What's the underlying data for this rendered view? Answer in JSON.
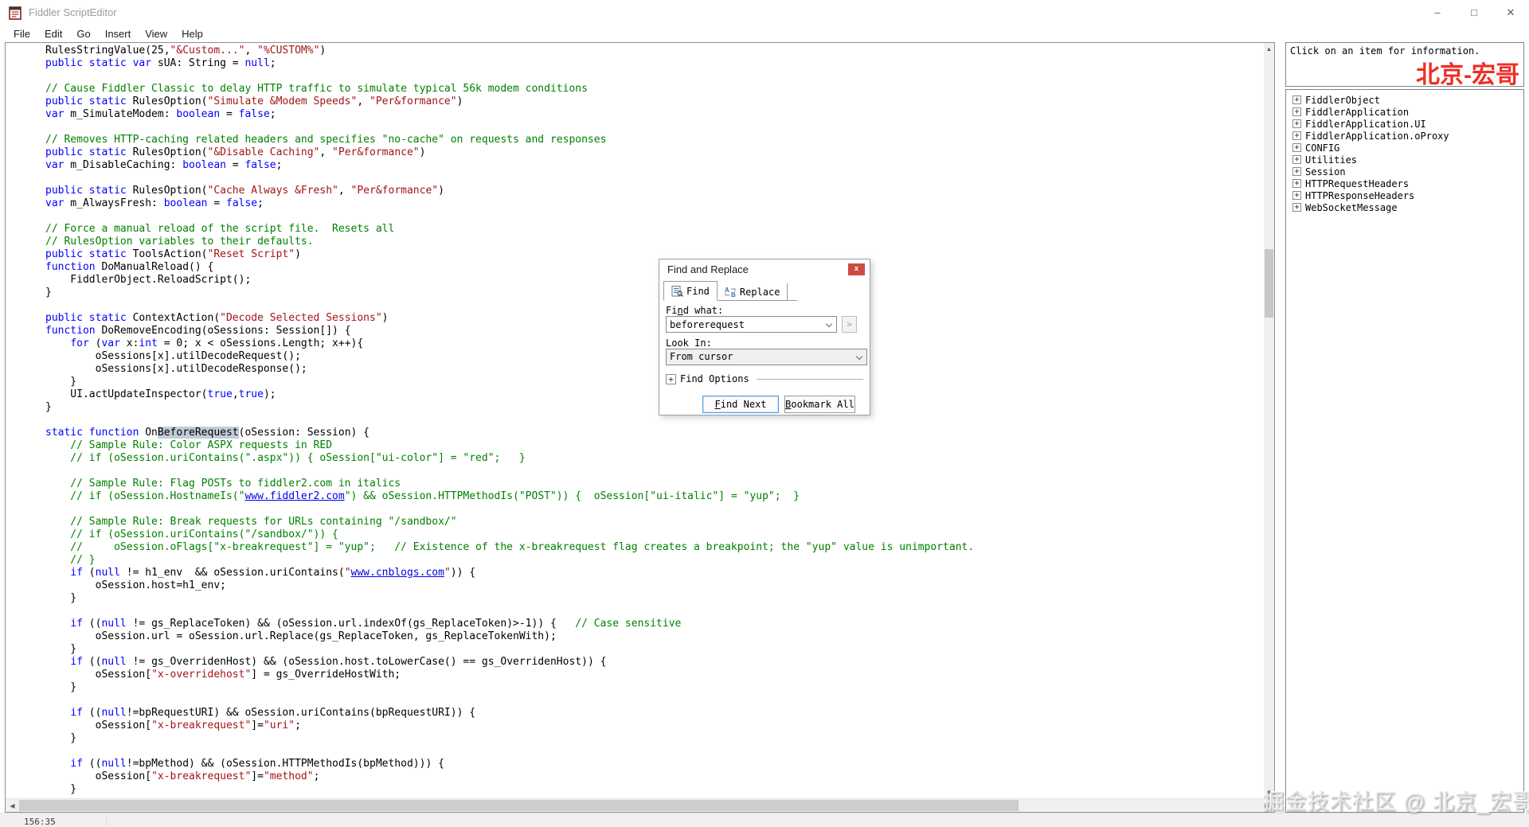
{
  "window": {
    "title": "Fiddler ScriptEditor",
    "menu": [
      "File",
      "Edit",
      "Go",
      "Insert",
      "View",
      "Help"
    ],
    "controls": {
      "minimize": "–",
      "maximize": "□",
      "close": "✕"
    }
  },
  "editor": {
    "status": "156:35",
    "lines": [
      [
        [
          "p",
          "RulesStringValue(25,"
        ],
        [
          "s",
          "\"&Custom...\""
        ],
        [
          "p",
          ", "
        ],
        [
          "s",
          "\"%CUSTOM%\""
        ],
        [
          "p",
          ")"
        ]
      ],
      [
        [
          "k",
          "public static var"
        ],
        [
          "p",
          " sUA: String = "
        ],
        [
          "k",
          "null"
        ],
        [
          "p",
          ";"
        ]
      ],
      [],
      [
        [
          "c",
          "// Cause Fiddler Classic to delay HTTP traffic to simulate typical 56k modem conditions"
        ]
      ],
      [
        [
          "k",
          "public static"
        ],
        [
          "p",
          " RulesOption("
        ],
        [
          "s",
          "\"Simulate &Modem Speeds\""
        ],
        [
          "p",
          ", "
        ],
        [
          "s",
          "\"Per&formance\""
        ],
        [
          "p",
          ")"
        ]
      ],
      [
        [
          "k",
          "var"
        ],
        [
          "p",
          " m_SimulateModem: "
        ],
        [
          "k",
          "boolean"
        ],
        [
          "p",
          " = "
        ],
        [
          "k",
          "false"
        ],
        [
          "p",
          ";"
        ]
      ],
      [],
      [
        [
          "c",
          "// Removes HTTP-caching related headers and specifies \"no-cache\" on requests and responses"
        ]
      ],
      [
        [
          "k",
          "public static"
        ],
        [
          "p",
          " RulesOption("
        ],
        [
          "s",
          "\"&Disable Caching\""
        ],
        [
          "p",
          ", "
        ],
        [
          "s",
          "\"Per&formance\""
        ],
        [
          "p",
          ")"
        ]
      ],
      [
        [
          "k",
          "var"
        ],
        [
          "p",
          " m_DisableCaching: "
        ],
        [
          "k",
          "boolean"
        ],
        [
          "p",
          " = "
        ],
        [
          "k",
          "false"
        ],
        [
          "p",
          ";"
        ]
      ],
      [],
      [
        [
          "k",
          "public static"
        ],
        [
          "p",
          " RulesOption("
        ],
        [
          "s",
          "\"Cache Always &Fresh\""
        ],
        [
          "p",
          ", "
        ],
        [
          "s",
          "\"Per&formance\""
        ],
        [
          "p",
          ")"
        ]
      ],
      [
        [
          "k",
          "var"
        ],
        [
          "p",
          " m_AlwaysFresh: "
        ],
        [
          "k",
          "boolean"
        ],
        [
          "p",
          " = "
        ],
        [
          "k",
          "false"
        ],
        [
          "p",
          ";"
        ]
      ],
      [],
      [
        [
          "c",
          "// Force a manual reload of the script file.  Resets all"
        ]
      ],
      [
        [
          "c",
          "// RulesOption variables to their defaults."
        ]
      ],
      [
        [
          "k",
          "public static"
        ],
        [
          "p",
          " ToolsAction("
        ],
        [
          "s",
          "\"Reset Script\""
        ],
        [
          "p",
          ")"
        ]
      ],
      [
        [
          "k",
          "function"
        ],
        [
          "p",
          " DoManualReload() {"
        ]
      ],
      [
        [
          "p",
          "    FiddlerObject.ReloadScript();"
        ]
      ],
      [
        [
          "p",
          "}"
        ]
      ],
      [],
      [
        [
          "k",
          "public static"
        ],
        [
          "p",
          " ContextAction("
        ],
        [
          "s",
          "\"Decode Selected Sessions\""
        ],
        [
          "p",
          ")"
        ]
      ],
      [
        [
          "k",
          "function"
        ],
        [
          "p",
          " DoRemoveEncoding(oSessions: Session[]) {"
        ]
      ],
      [
        [
          "p",
          "    "
        ],
        [
          "k",
          "for"
        ],
        [
          "p",
          " ("
        ],
        [
          "k",
          "var"
        ],
        [
          "p",
          " x:"
        ],
        [
          "k",
          "int"
        ],
        [
          "p",
          " = 0; x < oSessions.Length; x++){"
        ]
      ],
      [
        [
          "p",
          "        oSessions[x].utilDecodeRequest();"
        ]
      ],
      [
        [
          "p",
          "        oSessions[x].utilDecodeResponse();"
        ]
      ],
      [
        [
          "p",
          "    }"
        ]
      ],
      [
        [
          "p",
          "    UI.actUpdateInspector("
        ],
        [
          "k",
          "true"
        ],
        [
          "p",
          ","
        ],
        [
          "k",
          "true"
        ],
        [
          "p",
          ");"
        ]
      ],
      [
        [
          "p",
          "}"
        ]
      ],
      [],
      [
        [
          "k",
          "static function"
        ],
        [
          "p",
          " On"
        ],
        [
          "hl",
          "BeforeRequest"
        ],
        [
          "p",
          "(oSession: Session) {"
        ]
      ],
      [
        [
          "c",
          "    // Sample Rule: Color ASPX requests in RED"
        ]
      ],
      [
        [
          "c",
          "    // if (oSession.uriContains(\".aspx\")) { oSession[\"ui-color\"] = \"red\";   }"
        ]
      ],
      [],
      [
        [
          "c",
          "    // Sample Rule: Flag POSTs to fiddler2.com in italics"
        ]
      ],
      [
        [
          "c",
          "    // if (oSession.HostnameIs(\""
        ],
        [
          "u",
          "www.fiddler2.com"
        ],
        [
          "c",
          "\") && oSession.HTTPMethodIs(\"POST\")) {  oSession[\"ui-italic\"] = \"yup\";  }"
        ]
      ],
      [],
      [
        [
          "c",
          "    // Sample Rule: Break requests for URLs containing \"/sandbox/\""
        ]
      ],
      [
        [
          "c",
          "    // if (oSession.uriContains(\"/sandbox/\")) {"
        ]
      ],
      [
        [
          "c",
          "    //     oSession.oFlags[\"x-breakrequest\"] = \"yup\";   // Existence of the x-breakrequest flag creates a breakpoint; the \"yup\" value is unimportant."
        ]
      ],
      [
        [
          "c",
          "    // }"
        ]
      ],
      [
        [
          "p",
          "    "
        ],
        [
          "k",
          "if"
        ],
        [
          "p",
          " ("
        ],
        [
          "k",
          "null"
        ],
        [
          "p",
          " != h1_env  && oSession.uriContains("
        ],
        [
          "s",
          "\""
        ],
        [
          "u",
          "www.cnblogs.com"
        ],
        [
          "s",
          "\""
        ],
        [
          "p",
          ")) {"
        ]
      ],
      [
        [
          "p",
          "        oSession.host=h1_env;"
        ]
      ],
      [
        [
          "p",
          "    }"
        ]
      ],
      [],
      [
        [
          "p",
          "    "
        ],
        [
          "k",
          "if"
        ],
        [
          "p",
          " (("
        ],
        [
          "k",
          "null"
        ],
        [
          "p",
          " != gs_ReplaceToken) && (oSession.url.indexOf(gs_ReplaceToken)>-1)) {   "
        ],
        [
          "c",
          "// Case sensitive"
        ]
      ],
      [
        [
          "p",
          "        oSession.url = oSession.url.Replace(gs_ReplaceToken, gs_ReplaceTokenWith);"
        ]
      ],
      [
        [
          "p",
          "    }"
        ]
      ],
      [
        [
          "p",
          "    "
        ],
        [
          "k",
          "if"
        ],
        [
          "p",
          " (("
        ],
        [
          "k",
          "null"
        ],
        [
          "p",
          " != gs_OverridenHost) && (oSession.host.toLowerCase() == gs_OverridenHost)) {"
        ]
      ],
      [
        [
          "p",
          "        oSession["
        ],
        [
          "s",
          "\"x-overridehost\""
        ],
        [
          "p",
          "] = gs_OverrideHostWith;"
        ]
      ],
      [
        [
          "p",
          "    }"
        ]
      ],
      [],
      [
        [
          "p",
          "    "
        ],
        [
          "k",
          "if"
        ],
        [
          "p",
          " (("
        ],
        [
          "k",
          "null"
        ],
        [
          "p",
          "!=bpRequestURI) && oSession.uriContains(bpRequestURI)) {"
        ]
      ],
      [
        [
          "p",
          "        oSession["
        ],
        [
          "s",
          "\"x-breakrequest\""
        ],
        [
          "p",
          "]="
        ],
        [
          "s",
          "\"uri\""
        ],
        [
          "p",
          ";"
        ]
      ],
      [
        [
          "p",
          "    }"
        ]
      ],
      [],
      [
        [
          "p",
          "    "
        ],
        [
          "k",
          "if"
        ],
        [
          "p",
          " (("
        ],
        [
          "k",
          "null"
        ],
        [
          "p",
          "!=bpMethod) && (oSession.HTTPMethodIs(bpMethod))) {"
        ]
      ],
      [
        [
          "p",
          "        oSession["
        ],
        [
          "s",
          "\"x-breakrequest\""
        ],
        [
          "p",
          "]="
        ],
        [
          "s",
          "\"method\""
        ],
        [
          "p",
          ";"
        ]
      ],
      [
        [
          "p",
          "    }"
        ]
      ]
    ]
  },
  "dialog": {
    "title": "Find and Replace",
    "close_glyph": "x",
    "tabs": {
      "find": "Find",
      "replace": "Replace"
    },
    "find_what_label": {
      "t": "Find what:",
      "u": 2
    },
    "find_value": "beforerequest",
    "look_in_label": "Look In:",
    "look_in_value": "From cursor",
    "expand_glyph": "+",
    "options_label": "Find Options",
    "next_arrow_glyph": ">",
    "find_next_btn": {
      "t": "Find Next",
      "u": 0
    },
    "bookmark_all_btn": {
      "t": "Bookmark All",
      "u": 0
    }
  },
  "sidebar": {
    "info": "Click on an item for information.",
    "red_watermark": "北京-宏哥",
    "expand_glyph": "+",
    "tree": [
      "FiddlerObject",
      "FiddlerApplication",
      "FiddlerApplication.UI",
      "FiddlerApplication.oProxy",
      "CONFIG",
      "Utilities",
      "Session",
      "HTTPRequestHeaders",
      "HTTPResponseHeaders",
      "WebSocketMessage"
    ]
  },
  "watermark_bottom": "掘金技术社区 @ 北京_宏哥",
  "colors": {
    "keyword": "#0000ff",
    "string": "#a31515",
    "comment": "#008000",
    "link": "#0000ee",
    "selection": "#c2ccd9",
    "red_text": "#ed2f27",
    "close_btn": "#cc4b44"
  }
}
